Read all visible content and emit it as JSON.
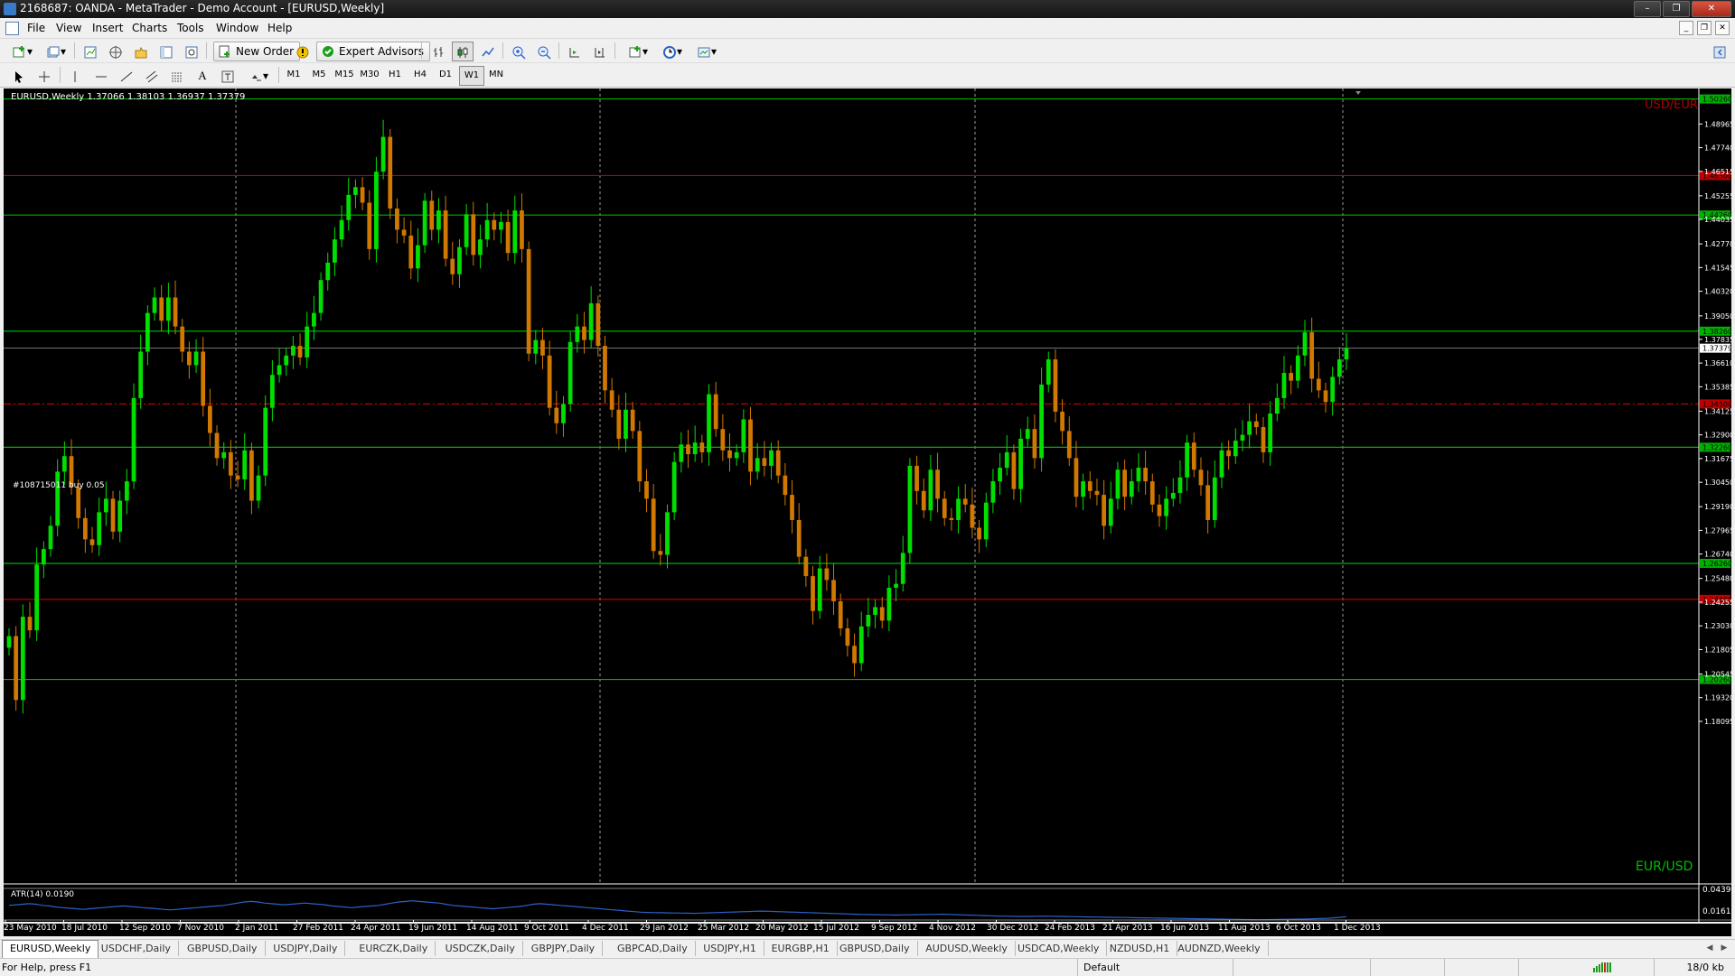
{
  "window": {
    "title": "2168687: OANDA - MetaTrader - Demo Account - [EURUSD,Weekly]",
    "controls": [
      "–",
      "❐",
      "✕"
    ]
  },
  "menu": {
    "items": [
      "File",
      "View",
      "Insert",
      "Charts",
      "Tools",
      "Window",
      "Help"
    ]
  },
  "toolbar": {
    "new_order": "New Order",
    "expert_advisors": "Expert Advisors",
    "timeframes": [
      "M1",
      "M5",
      "M15",
      "M30",
      "H1",
      "H4",
      "D1",
      "W1",
      "MN"
    ],
    "active_timeframe": "W1",
    "icons": [
      "new-chart-icon",
      "profiles-icon",
      "market-watch-icon",
      "navigator-icon",
      "data-window-icon",
      "terminal-icon",
      "strategy-tester-icon",
      "zoom-in-icon",
      "zoom-out-icon",
      "bar-chart-icon",
      "candlestick-icon",
      "line-chart-icon",
      "auto-scroll-icon",
      "chart-shift-icon",
      "indicators-icon",
      "periods-icon",
      "templates-icon"
    ]
  },
  "chart": {
    "info": "EURUSD,Weekly  1.37066 1.38103 1.36937 1.37379",
    "symbol_label": "EUR/USD",
    "ghost_label": "USD/EUR",
    "order_label": "#108715011 buy 0.05",
    "colors": {
      "background": "#000000",
      "bull": "#00e000",
      "bear": "#d07800",
      "support_line": "#00b000",
      "resistance_line": "#c00000",
      "order_line": "#c00000",
      "atr_line": "#2a62c9",
      "grid": "#9a9a9a",
      "axis_text": "#ffffff"
    }
  },
  "indicator": {
    "label": "ATR(14) 0.0190",
    "scale": [
      "0.0439",
      "0.0161"
    ]
  },
  "tabs": [
    "EURUSD,Weekly",
    "USDCHF,Daily",
    "GBPUSD,Daily",
    "USDJPY,Daily",
    "EURCZK,Daily",
    "USDCZK,Daily",
    "GBPJPY,Daily",
    "GBPCAD,Daily",
    "USDJPY,H1",
    "EURGBP,H1",
    "GBPUSD,Daily",
    "AUDUSD,Weekly",
    "USDCAD,Weekly",
    "NZDUSD,H1",
    "AUDNZD,Weekly"
  ],
  "active_tab": "EURUSD,Weekly",
  "status": {
    "help": "For Help, press F1",
    "profile": "Default",
    "traffic": "18/0 kb"
  },
  "chart_data": {
    "type": "candlestick",
    "title": "EURUSD,Weekly",
    "ylim": [
      1.18,
      1.508
    ],
    "price_ticks": [
      "1.48965",
      "1.47740",
      "1.46515",
      "1.45255",
      "1.44035",
      "1.42770",
      "1.41545",
      "1.40320",
      "1.39050",
      "1.37835",
      "1.36610",
      "1.35385",
      "1.34125",
      "1.32900",
      "1.31675",
      "1.30450",
      "1.29190",
      "1.27965",
      "1.26740",
      "1.25480",
      "1.24255",
      "1.23030",
      "1.21805",
      "1.20545",
      "1.19320",
      "1.18095"
    ],
    "date_labels": [
      "23 May 2010",
      "18 Jul 2010",
      "12 Sep 2010",
      "7 Nov 2010",
      "2 Jan 2011",
      "27 Feb 2011",
      "24 Apr 2011",
      "19 Jun 2011",
      "14 Aug 2011",
      "9 Oct 2011",
      "4 Dec 2011",
      "29 Jan 2012",
      "25 Mar 2012",
      "20 May 2012",
      "15 Jul 2012",
      "9 Sep 2012",
      "4 Nov 2012",
      "30 Dec 2012",
      "24 Feb 2013",
      "21 Apr 2013",
      "16 Jun 2013",
      "11 Aug 2013",
      "6 Oct 2013",
      "1 Dec 2013"
    ],
    "horizontal_lines": [
      {
        "price": 1.5026,
        "label": "1.50260",
        "kind": "support"
      },
      {
        "price": 1.463,
        "label": "1.46300",
        "kind": "resistance"
      },
      {
        "price": 1.4426,
        "label": "1.44260",
        "kind": "support"
      },
      {
        "price": 1.3826,
        "label": "1.38260",
        "kind": "support"
      },
      {
        "price": 1.345,
        "label": "1.34500",
        "kind": "order"
      },
      {
        "price": 1.3226,
        "label": "1.32260",
        "kind": "support"
      },
      {
        "price": 1.2626,
        "label": "1.26260",
        "kind": "support"
      },
      {
        "price": 1.244,
        "label": "1.24400",
        "kind": "resistance"
      },
      {
        "price": 1.2026,
        "label": "1.20260",
        "kind": "support"
      }
    ],
    "current_price": {
      "price": 1.37379,
      "label": "1.37379"
    },
    "weekly_closes": [
      1.225,
      1.192,
      1.235,
      1.228,
      1.262,
      1.27,
      1.282,
      1.31,
      1.318,
      1.302,
      1.286,
      1.275,
      1.272,
      1.289,
      1.296,
      1.279,
      1.295,
      1.305,
      1.348,
      1.372,
      1.392,
      1.4,
      1.388,
      1.4,
      1.385,
      1.372,
      1.365,
      1.372,
      1.344,
      1.33,
      1.317,
      1.32,
      1.308,
      1.306,
      1.321,
      1.295,
      1.308,
      1.343,
      1.36,
      1.365,
      1.37,
      1.375,
      1.369,
      1.385,
      1.392,
      1.409,
      1.418,
      1.43,
      1.44,
      1.453,
      1.457,
      1.449,
      1.425,
      1.465,
      1.483,
      1.446,
      1.435,
      1.432,
      1.415,
      1.427,
      1.45,
      1.435,
      1.445,
      1.42,
      1.412,
      1.426,
      1.443,
      1.422,
      1.43,
      1.44,
      1.435,
      1.439,
      1.423,
      1.445,
      1.425,
      1.371,
      1.378,
      1.37,
      1.343,
      1.335,
      1.345,
      1.377,
      1.385,
      1.378,
      1.397,
      1.375,
      1.352,
      1.342,
      1.327,
      1.342,
      1.331,
      1.305,
      1.296,
      1.269,
      1.267,
      1.289,
      1.315,
      1.324,
      1.319,
      1.325,
      1.32,
      1.35,
      1.332,
      1.321,
      1.317,
      1.32,
      1.337,
      1.31,
      1.317,
      1.313,
      1.321,
      1.308,
      1.298,
      1.285,
      1.266,
      1.256,
      1.238,
      1.26,
      1.254,
      1.243,
      1.229,
      1.22,
      1.211,
      1.23,
      1.236,
      1.24,
      1.233,
      1.25,
      1.252,
      1.268,
      1.313,
      1.3,
      1.29,
      1.311,
      1.296,
      1.286,
      1.285,
      1.296,
      1.293,
      1.281,
      1.275,
      1.294,
      1.305,
      1.312,
      1.32,
      1.301,
      1.327,
      1.332,
      1.317,
      1.355,
      1.368,
      1.341,
      1.331,
      1.317,
      1.297,
      1.305,
      1.3,
      1.298,
      1.282,
      1.296,
      1.311,
      1.297,
      1.305,
      1.312,
      1.305,
      1.293,
      1.287,
      1.296,
      1.299,
      1.307,
      1.325,
      1.311,
      1.303,
      1.285,
      1.307,
      1.321,
      1.318,
      1.326,
      1.329,
      1.336,
      1.333,
      1.32,
      1.34,
      1.348,
      1.361,
      1.357,
      1.37,
      1.382,
      1.358,
      1.352,
      1.346,
      1.359,
      1.368,
      1.374
    ],
    "atr_values": [
      0.029,
      0.0295,
      0.03,
      0.0305,
      0.03,
      0.029,
      0.0285,
      0.0275,
      0.027,
      0.0265,
      0.026,
      0.0255,
      0.026,
      0.0265,
      0.027,
      0.0275,
      0.028,
      0.0285,
      0.028,
      0.0275,
      0.027,
      0.0265,
      0.026,
      0.0255,
      0.025,
      0.0255,
      0.026,
      0.0265,
      0.027,
      0.0275,
      0.028,
      0.0285,
      0.029,
      0.03,
      0.031,
      0.032,
      0.0325,
      0.032,
      0.031,
      0.0305,
      0.03,
      0.0295,
      0.03,
      0.0305,
      0.031,
      0.0305,
      0.03,
      0.0295,
      0.0285,
      0.028,
      0.0275,
      0.027,
      0.0275,
      0.028,
      0.0285,
      0.029,
      0.03,
      0.031,
      0.032,
      0.0325,
      0.033,
      0.0325,
      0.032,
      0.0315,
      0.031,
      0.03,
      0.029,
      0.0285,
      0.028,
      0.0275,
      0.027,
      0.0265,
      0.026,
      0.0265,
      0.027,
      0.0275,
      0.028,
      0.029,
      0.03,
      0.0305,
      0.03,
      0.0295,
      0.029,
      0.0285,
      0.028,
      0.0275,
      0.027,
      0.0265,
      0.026,
      0.0255,
      0.025,
      0.0245,
      0.024,
      0.0235,
      0.023,
      0.0228,
      0.0226,
      0.0225,
      0.0224,
      0.0223,
      0.0222,
      0.0221,
      0.022,
      0.0222,
      0.0224,
      0.0226,
      0.0228,
      0.023,
      0.0232,
      0.0234,
      0.0236,
      0.0238,
      0.024,
      0.0238,
      0.0236,
      0.0234,
      0.0232,
      0.023,
      0.0228,
      0.0226,
      0.0224,
      0.0222,
      0.022,
      0.0218,
      0.0216,
      0.0214,
      0.0212,
      0.021,
      0.0209,
      0.0208,
      0.0207,
      0.0206,
      0.0205,
      0.0206,
      0.0207,
      0.0208,
      0.0209,
      0.021,
      0.0211,
      0.0212,
      0.021,
      0.0208,
      0.0206,
      0.0204,
      0.0202,
      0.02,
      0.0198,
      0.0196,
      0.0195,
      0.0194,
      0.0193,
      0.0192,
      0.0193,
      0.0194,
      0.0195,
      0.0194,
      0.0193,
      0.0192,
      0.0191,
      0.019,
      0.0189,
      0.0188,
      0.0187,
      0.0186,
      0.0185,
      0.0184,
      0.0183,
      0.0182,
      0.0181,
      0.018,
      0.0179,
      0.0178,
      0.0177,
      0.0176,
      0.0175,
      0.0174,
      0.0173,
      0.0172,
      0.0171,
      0.017,
      0.0169,
      0.0168,
      0.0167,
      0.0166,
      0.0165,
      0.0164,
      0.0163,
      0.0164,
      0.0165,
      0.0166,
      0.0167,
      0.0168,
      0.0169,
      0.017,
      0.0172,
      0.0174,
      0.0176,
      0.018,
      0.0185,
      0.019
    ]
  }
}
